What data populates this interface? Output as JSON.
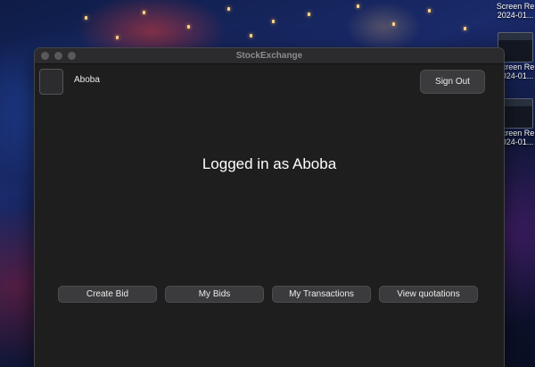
{
  "window": {
    "title": "StockExchange"
  },
  "user": {
    "name": "Aboba"
  },
  "header": {
    "sign_out_label": "Sign Out"
  },
  "main": {
    "status_text": "Logged in as Aboba"
  },
  "actions": [
    {
      "label": "Create Bid"
    },
    {
      "label": "My Bids"
    },
    {
      "label": "My Transactions"
    },
    {
      "label": "View quotations"
    }
  ],
  "desktop": {
    "icons": [
      {
        "label_line1": "Screen Re",
        "label_line2": "2024-01..."
      },
      {
        "label_line1": "Screen Re",
        "label_line2": "2024-01..."
      },
      {
        "label_line1": "Screen Re",
        "label_line2": "2024-01..."
      }
    ]
  }
}
